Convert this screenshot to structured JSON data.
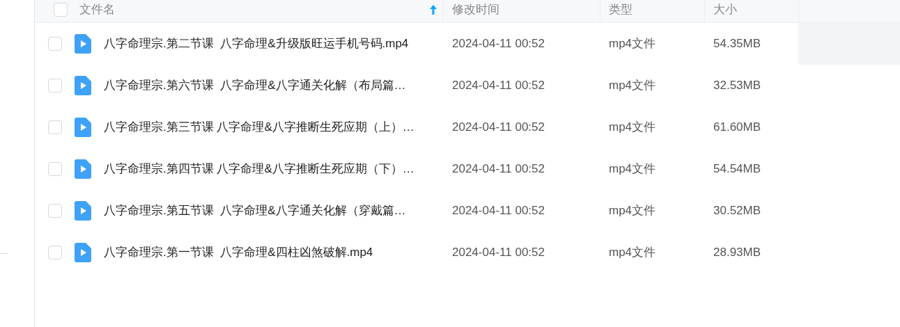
{
  "table": {
    "header": {
      "checked": false,
      "columns": [
        {
          "label": "文件名",
          "sorted": true
        },
        {
          "label": "修改时间",
          "sorted": false
        },
        {
          "label": "类型",
          "sorted": false
        },
        {
          "label": "大小",
          "sorted": false
        }
      ]
    },
    "rows": [
      {
        "checked": false,
        "hovered": true,
        "name": "八字命理宗.第二节课  八字命理&升级版旺运手机号码.mp4",
        "modified": "2024-04-11 00:52",
        "type": "mp4文件",
        "size": "54.35MB"
      },
      {
        "checked": false,
        "hovered": false,
        "name": "八字命理宗.第六节课  八字命理&八字通关化解（布局篇…",
        "modified": "2024-04-11 00:52",
        "type": "mp4文件",
        "size": "32.53MB"
      },
      {
        "checked": false,
        "hovered": false,
        "name": "八字命理宗.第三节课 八字命理&八字推断生死应期（上）…",
        "modified": "2024-04-11 00:52",
        "type": "mp4文件",
        "size": "61.60MB"
      },
      {
        "checked": false,
        "hovered": false,
        "name": "八字命理宗.第四节课 八字命理&八字推断生死应期（下）…",
        "modified": "2024-04-11 00:52",
        "type": "mp4文件",
        "size": "54.54MB"
      },
      {
        "checked": false,
        "hovered": false,
        "name": "八字命理宗.第五节课  八字命理&八字通关化解（穿戴篇…",
        "modified": "2024-04-11 00:52",
        "type": "mp4文件",
        "size": "30.52MB"
      },
      {
        "checked": false,
        "hovered": false,
        "name": "八字命理宗.第一节课  八字命理&四柱凶煞破解.mp4",
        "modified": "2024-04-11 00:52",
        "type": "mp4文件",
        "size": "28.93MB"
      }
    ]
  }
}
